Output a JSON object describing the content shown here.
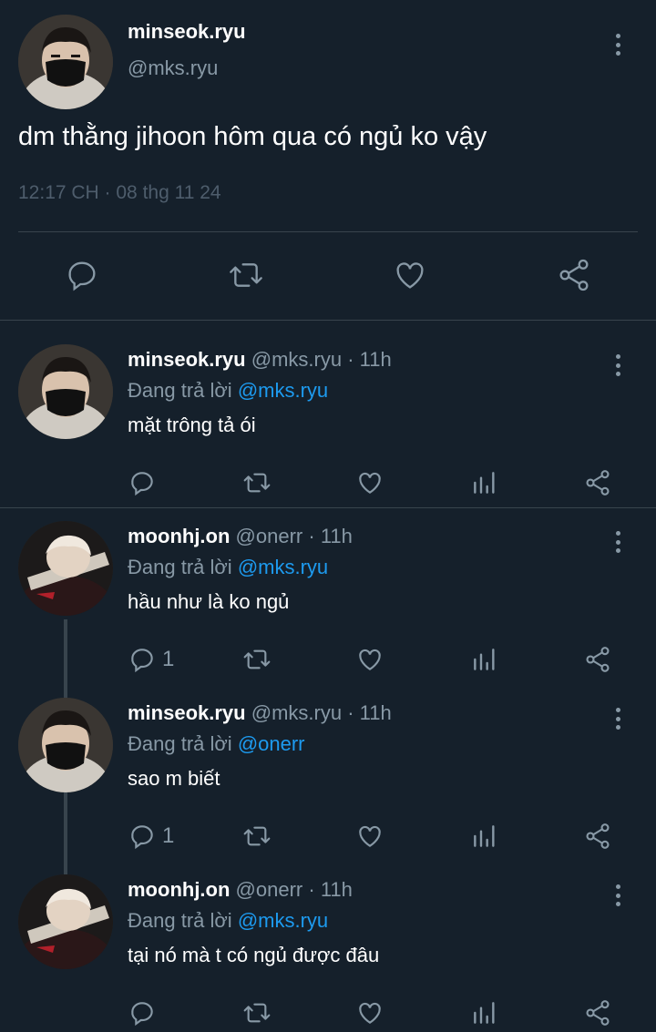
{
  "main_tweet": {
    "name": "minseok.ryu",
    "handle": "@mks.ryu",
    "text": "dm thằng jihoon hôm qua có ngủ ko vậy",
    "timestamp": "12:17 CH · 08 thg 11 24",
    "actions": [
      "reply-icon",
      "retweet-icon",
      "like-icon",
      "share-icon"
    ]
  },
  "replies": [
    {
      "name": "minseok.ryu",
      "handle": "@mks.ryu",
      "dot": "·",
      "time": "11h",
      "replying_prefix": "Đang trả lời ",
      "replying_to": "@mks.ryu",
      "text": "mặt trông tả ói",
      "reply_count": "",
      "avatar": "masked-avatar"
    },
    {
      "name": "moonhj.on",
      "handle": "@onerr",
      "dot": "·",
      "time": "11h",
      "replying_prefix": "Đang trả lời ",
      "replying_to": "@mks.ryu",
      "text": "hầu như là ko ngủ",
      "reply_count": "1",
      "avatar": "seatbelt-avatar"
    },
    {
      "name": "minseok.ryu",
      "handle": "@mks.ryu",
      "dot": "·",
      "time": "11h",
      "replying_prefix": "Đang trả lời ",
      "replying_to": "@onerr",
      "text": "sao m biết",
      "reply_count": "1",
      "avatar": "masked-avatar"
    },
    {
      "name": "moonhj.on",
      "handle": "@onerr",
      "dot": "·",
      "time": "11h",
      "replying_prefix": "Đang trả lời ",
      "replying_to": "@mks.ryu",
      "text": "tại nó mà t có ngủ được đâu",
      "reply_count": "",
      "avatar": "seatbelt-avatar"
    }
  ],
  "colors": {
    "background": "#15202b",
    "secondary_text": "#8899a6",
    "mention": "#1d9bf0",
    "divider": "#38444d"
  }
}
